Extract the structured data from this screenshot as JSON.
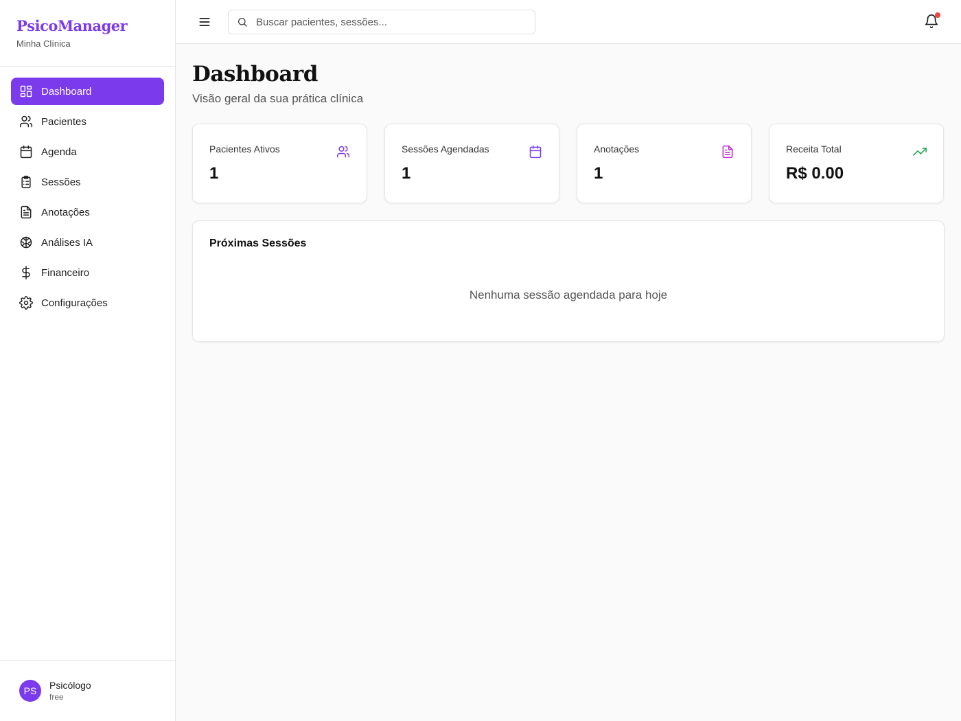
{
  "brand": {
    "title": "PsicoManager",
    "subtitle": "Minha Clínica"
  },
  "sidebar": {
    "items": [
      {
        "label": "Dashboard",
        "icon": "layout-grid-icon",
        "active": true
      },
      {
        "label": "Pacientes",
        "icon": "users-icon"
      },
      {
        "label": "Agenda",
        "icon": "calendar-icon"
      },
      {
        "label": "Sessões",
        "icon": "clipboard-list-icon"
      },
      {
        "label": "Anotações",
        "icon": "file-text-icon"
      },
      {
        "label": "Análises IA",
        "icon": "brain-icon"
      },
      {
        "label": "Financeiro",
        "icon": "dollar-sign-icon"
      },
      {
        "label": "Configurações",
        "icon": "settings-icon"
      }
    ]
  },
  "user": {
    "initials": "PS",
    "name": "Psicólogo",
    "plan": "free"
  },
  "topbar": {
    "search_placeholder": "Buscar pacientes, sessões..."
  },
  "page": {
    "title": "Dashboard",
    "subtitle": "Visão geral da sua prática clínica"
  },
  "stats": [
    {
      "label": "Pacientes Ativos",
      "value": "1",
      "icon": "users-icon",
      "color": "#7c3aed"
    },
    {
      "label": "Sessões Agendadas",
      "value": "1",
      "icon": "calendar-icon",
      "color": "#7c3aed"
    },
    {
      "label": "Anotações",
      "value": "1",
      "icon": "file-text-icon",
      "color": "#c026d3"
    },
    {
      "label": "Receita Total",
      "value": "R$ 0.00",
      "icon": "trending-up-icon",
      "color": "#16a34a"
    }
  ],
  "upcoming": {
    "title": "Próximas Sessões",
    "empty_message": "Nenhuma sessão agendada para hoje"
  },
  "colors": {
    "accent": "#7c3aed",
    "notification": "#ef4444"
  }
}
